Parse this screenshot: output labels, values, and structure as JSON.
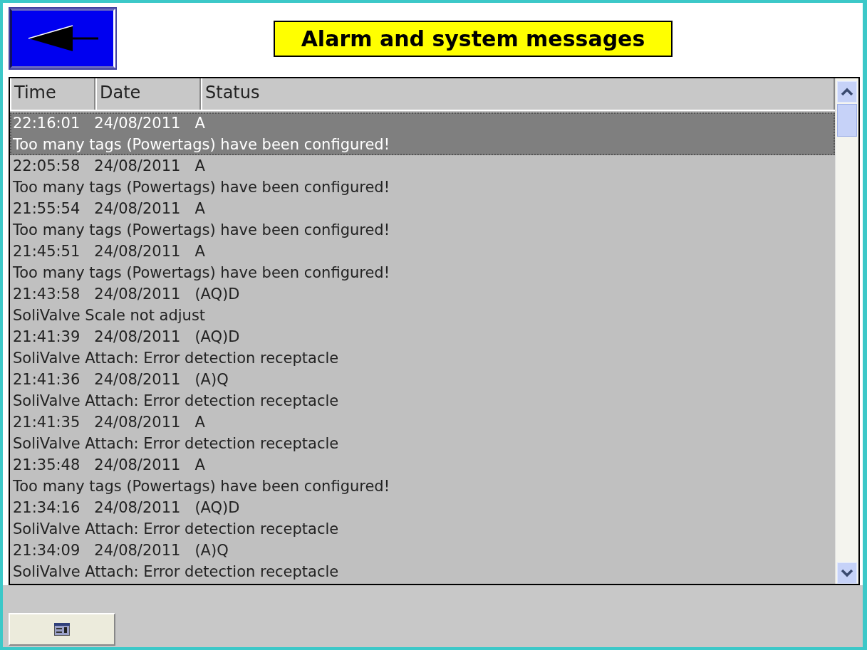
{
  "title": "Alarm and system messages",
  "columns": [
    "Time",
    "Date",
    "Status"
  ],
  "messages": [
    {
      "time": "22:16:01",
      "date": "24/08/2011",
      "status": "A",
      "text": "Too many tags (Powertags) have been configured!",
      "selected": true
    },
    {
      "time": "22:05:58",
      "date": "24/08/2011",
      "status": "A",
      "text": "Too many tags (Powertags) have been configured!",
      "selected": false
    },
    {
      "time": "21:55:54",
      "date": "24/08/2011",
      "status": "A",
      "text": "Too many tags (Powertags) have been configured!",
      "selected": false
    },
    {
      "time": "21:45:51",
      "date": "24/08/2011",
      "status": "A",
      "text": "Too many tags (Powertags) have been configured!",
      "selected": false
    },
    {
      "time": "21:43:58",
      "date": "24/08/2011",
      "status": "(AQ)D",
      "text": "SoliValve Scale not adjust",
      "selected": false
    },
    {
      "time": "21:41:39",
      "date": "24/08/2011",
      "status": "(AQ)D",
      "text": "SoliValve Attach: Error detection receptacle",
      "selected": false
    },
    {
      "time": "21:41:36",
      "date": "24/08/2011",
      "status": "(A)Q",
      "text": "SoliValve Attach: Error detection receptacle",
      "selected": false
    },
    {
      "time": "21:41:35",
      "date": "24/08/2011",
      "status": "A",
      "text": "SoliValve Attach: Error detection receptacle",
      "selected": false
    },
    {
      "time": "21:35:48",
      "date": "24/08/2011",
      "status": "A",
      "text": "Too many tags (Powertags) have been configured!",
      "selected": false
    },
    {
      "time": "21:34:16",
      "date": "24/08/2011",
      "status": "(AQ)D",
      "text": "SoliValve Attach: Error detection receptacle",
      "selected": false
    },
    {
      "time": "21:34:09",
      "date": "24/08/2011",
      "status": "(A)Q",
      "text": "SoliValve Attach: Error detection receptacle",
      "selected": false
    }
  ]
}
